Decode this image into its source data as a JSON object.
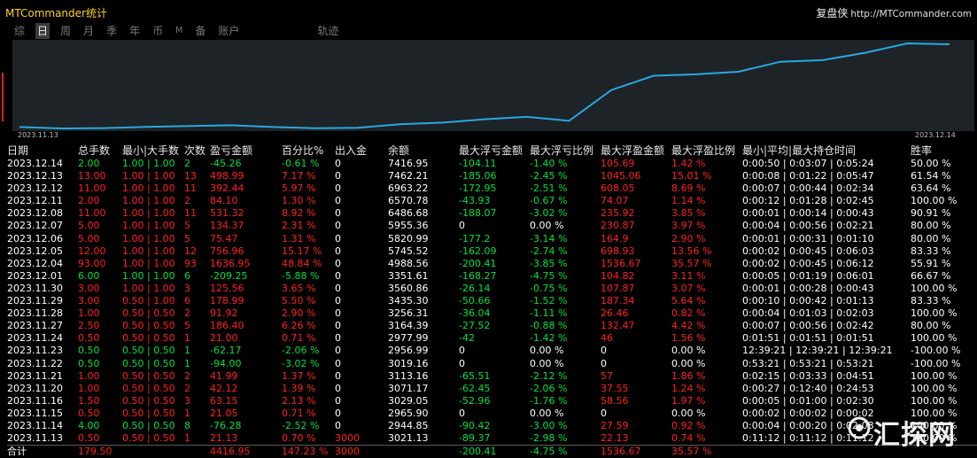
{
  "app": {
    "title": "MTCommander统计"
  },
  "brand": {
    "name": "复盘侠",
    "url": "http://MTCommander.com"
  },
  "tabs": [
    {
      "label": "综",
      "active": false,
      "small": false
    },
    {
      "label": "日",
      "active": true,
      "small": false
    },
    {
      "label": "周",
      "active": false,
      "small": false
    },
    {
      "label": "月",
      "active": false,
      "small": false
    },
    {
      "label": "季",
      "active": false,
      "small": false
    },
    {
      "label": "年",
      "active": false,
      "small": false
    },
    {
      "label": "币",
      "active": false,
      "small": false
    },
    {
      "label": "M",
      "active": false,
      "small": true
    },
    {
      "label": "备",
      "active": false,
      "small": false
    },
    {
      "label": "账户",
      "active": false,
      "small": false
    },
    {
      "label": "轨迹",
      "active": false,
      "small": false,
      "track": true
    }
  ],
  "chart_data": {
    "type": "line",
    "x": [
      "2023.11.13",
      "2023.11.14",
      "2023.11.15",
      "2023.11.16",
      "2023.11.20",
      "2023.11.21",
      "2023.11.22",
      "2023.11.23",
      "2023.11.24",
      "2023.11.27",
      "2023.11.28",
      "2023.11.29",
      "2023.11.30",
      "2023.12.01",
      "2023.12.04",
      "2023.12.05",
      "2023.12.06",
      "2023.12.07",
      "2023.12.08",
      "2023.12.11",
      "2023.12.12",
      "2023.12.13",
      "2023.12.14"
    ],
    "series": [
      {
        "values": [
          3021.13,
          2944.85,
          2965.9,
          3029.05,
          3071.17,
          3113.16,
          3019.16,
          2956.99,
          2977.99,
          3164.39,
          3256.31,
          3435.3,
          3560.86,
          3351.61,
          4988.56,
          5745.52,
          5820.99,
          5955.36,
          6486.68,
          6570.78,
          6963.22,
          7462.21,
          7416.95
        ]
      }
    ],
    "start_label": "2023.11.13",
    "end_label": "2023.12.14",
    "line_color": "#29a8e0"
  },
  "table": {
    "headers": [
      "日期",
      "总手数",
      "最小|大手数",
      "次数",
      "盈亏金额",
      "百分比%",
      "出入金",
      "余额",
      "最大浮亏金额",
      "最大浮亏比例",
      "最大浮盈金额",
      "最大浮盈比例",
      "最小|平均|最大持仓时间",
      "胜率"
    ],
    "rows": [
      [
        "2023.12.14",
        "2.00",
        "1.00 | 1.00",
        "2",
        "-45.26",
        "-0.61 %",
        "0",
        "7416.95",
        "-104.11",
        "-1.40 %",
        "105.69",
        "1.42 %",
        "0:00:50 | 0:03:07 | 0:05:24",
        "50.00 %"
      ],
      [
        "2023.12.13",
        "13.00",
        "1.00 | 1.00",
        "13",
        "498.99",
        "7.17 %",
        "0",
        "7462.21",
        "-185.06",
        "-2.45 %",
        "1045.06",
        "15.01 %",
        "0:00:08 | 0:01:22 | 0:05:47",
        "61.54 %"
      ],
      [
        "2023.12.12",
        "11.00",
        "1.00 | 1.00",
        "11",
        "392.44",
        "5.97 %",
        "0",
        "6963.22",
        "-172.95",
        "-2.51 %",
        "608.05",
        "8.69 %",
        "0:00:07 | 0:00:44 | 0:02:34",
        "63.64 %"
      ],
      [
        "2023.12.11",
        "2.00",
        "1.00 | 1.00",
        "2",
        "84.10",
        "1.30 %",
        "0",
        "6570.78",
        "-43.93",
        "-0.67 %",
        "74.07",
        "1.14 %",
        "0:00:12 | 0:01:28 | 0:02:45",
        "100.00 %"
      ],
      [
        "2023.12.08",
        "11.00",
        "1.00 | 1.00",
        "11",
        "531.32",
        "8.92 %",
        "0",
        "6486.68",
        "-188.07",
        "-3.02 %",
        "235.92",
        "3.85 %",
        "0:00:01 | 0:00:14 | 0:00:43",
        "90.91 %"
      ],
      [
        "2023.12.07",
        "5.00",
        "1.00 | 1.00",
        "5",
        "134.37",
        "2.31 %",
        "0",
        "5955.36",
        "0",
        "0.00 %",
        "230.87",
        "3.97 %",
        "0:00:04 | 0:00:56 | 0:02:21",
        "80.00 %"
      ],
      [
        "2023.12.06",
        "5.00",
        "1.00 | 1.00",
        "5",
        "75.47",
        "1.31 %",
        "0",
        "5820.99",
        "-177.2",
        "-3.14 %",
        "164.9",
        "2.90 %",
        "0:00:01 | 0:00:31 | 0:01:10",
        "80.00 %"
      ],
      [
        "2023.12.05",
        "12.00",
        "1.00 | 1.00",
        "12",
        "756.96",
        "15.17 %",
        "0",
        "5745.52",
        "-162.09",
        "-2.74 %",
        "698.93",
        "13.56 %",
        "0:00:02 | 0:00:45 | 0:06:03",
        "83.33 %"
      ],
      [
        "2023.12.04",
        "93.00",
        "1.00 | 1.00",
        "93",
        "1636.95",
        "48.84 %",
        "0",
        "4988.56",
        "-200.41",
        "-3.85 %",
        "1536.67",
        "35.57 %",
        "0:00:02 | 0:00:45 | 0:06:12",
        "55.91 %"
      ],
      [
        "2023.12.01",
        "6.00",
        "1.00 | 1.00",
        "6",
        "-209.25",
        "-5.88 %",
        "0",
        "3351.61",
        "-168.27",
        "-4.75 %",
        "104.82",
        "3.11 %",
        "0:00:05 | 0:01:19 | 0:06:01",
        "66.67 %"
      ],
      [
        "2023.11.30",
        "3.00",
        "1.00 | 1.00",
        "3",
        "125.56",
        "3.65 %",
        "0",
        "3560.86",
        "-26.14",
        "-0.75 %",
        "107.87",
        "3.07 %",
        "0:00:01 | 0:00:28 | 0:00:43",
        "100.00 %"
      ],
      [
        "2023.11.29",
        "3.00",
        "0.50 | 1.00",
        "6",
        "178.99",
        "5.50 %",
        "0",
        "3435.30",
        "-50.66",
        "-1.52 %",
        "187.34",
        "5.64 %",
        "0:00:10 | 0:00:42 | 0:01:13",
        "83.33 %"
      ],
      [
        "2023.11.28",
        "1.00",
        "0.50 | 0.50",
        "2",
        "91.92",
        "2.90 %",
        "0",
        "3256.31",
        "-36.04",
        "-1.11 %",
        "26.46",
        "0.82 %",
        "0:00:04 | 0:01:03 | 0:02:03",
        "100.00 %"
      ],
      [
        "2023.11.27",
        "2.50",
        "0.50 | 0.50",
        "5",
        "186.40",
        "6.26 %",
        "0",
        "3164.39",
        "-27.52",
        "-0.88 %",
        "132.47",
        "4.42 %",
        "0:00:07 | 0:00:56 | 0:02:42",
        "80.00 %"
      ],
      [
        "2023.11.24",
        "0.50",
        "0.50 | 0.50",
        "1",
        "21.00",
        "0.71 %",
        "0",
        "2977.99",
        "-42",
        "-1.42 %",
        "46",
        "1.56 %",
        "0:01:51 | 0:01:51 | 0:01:51",
        "100.00 %"
      ],
      [
        "2023.11.23",
        "0.50",
        "0.50 | 0.50",
        "1",
        "-62.17",
        "-2.06 %",
        "0",
        "2956.99",
        "0",
        "0.00 %",
        "0",
        "0.00 %",
        "12:39:21 | 12:39:21 | 12:39:21",
        "-100.00 %"
      ],
      [
        "2023.11.22",
        "0.50",
        "0.50 | 0.50",
        "1",
        "-94.00",
        "-3.02 %",
        "0",
        "3019.16",
        "0",
        "0.00 %",
        "0",
        "0.00 %",
        "0:53:21 | 0:53:21 | 0:53:21",
        "-100.00 %"
      ],
      [
        "2023.11.21",
        "1.00",
        "0.50 | 0.50",
        "2",
        "41.99",
        "1.37 %",
        "0",
        "3113.16",
        "-65.51",
        "-2.12 %",
        "57",
        "1.86 %",
        "0:02:15 | 0:03:33 | 0:04:51",
        "100.00 %"
      ],
      [
        "2023.11.20",
        "1.00",
        "0.50 | 0.50",
        "2",
        "42.12",
        "1.39 %",
        "0",
        "3071.17",
        "-62.45",
        "-2.06 %",
        "37.55",
        "1.24 %",
        "0:00:27 | 0:12:40 | 0:24:53",
        "100.00 %"
      ],
      [
        "2023.11.16",
        "1.50",
        "0.50 | 0.50",
        "3",
        "63.15",
        "2.13 %",
        "0",
        "3029.05",
        "-52.96",
        "-1.76 %",
        "58.56",
        "1.97 %",
        "0:00:05 | 0:01:00 | 0:02:30",
        "100.00 %"
      ],
      [
        "2023.11.15",
        "0.50",
        "0.50 | 0.50",
        "1",
        "21.05",
        "0.71 %",
        "0",
        "2965.90",
        "0",
        "0.00 %",
        "0",
        "0.00 %",
        "0:00:02 | 0:00:02 | 0:00:02",
        "100.00 %"
      ],
      [
        "2023.11.14",
        "4.00",
        "0.50 | 0.50",
        "8",
        "-76.28",
        "-2.52 %",
        "0",
        "2944.85",
        "-90.42",
        "-3.00 %",
        "27.59",
        "0.92 %",
        "0:00:04 | 0:00:20 | 0:02:08",
        "100.00 %"
      ],
      [
        "2023.11.13",
        "0.50",
        "0.50 | 0.50",
        "1",
        "21.13",
        "0.70 %",
        "3000",
        "3021.13",
        "-89.37",
        "-2.98 %",
        "22.13",
        "0.74 %",
        "0:11:12 | 0:11:12 | 0:11:12",
        "100.00 %"
      ]
    ],
    "total": [
      "合计",
      "179.50",
      "",
      "",
      "4416.95",
      "147.23 %",
      "3000",
      "",
      "-200.41",
      "-4.75 %",
      "1536.67",
      "35.57 %",
      "",
      ""
    ]
  },
  "watermark": {
    "text": "汇探网"
  },
  "colors": {
    "positive": "#ff2020",
    "negative": "#00e040",
    "neutral": "#ffffff",
    "title": "#ffd21e"
  }
}
